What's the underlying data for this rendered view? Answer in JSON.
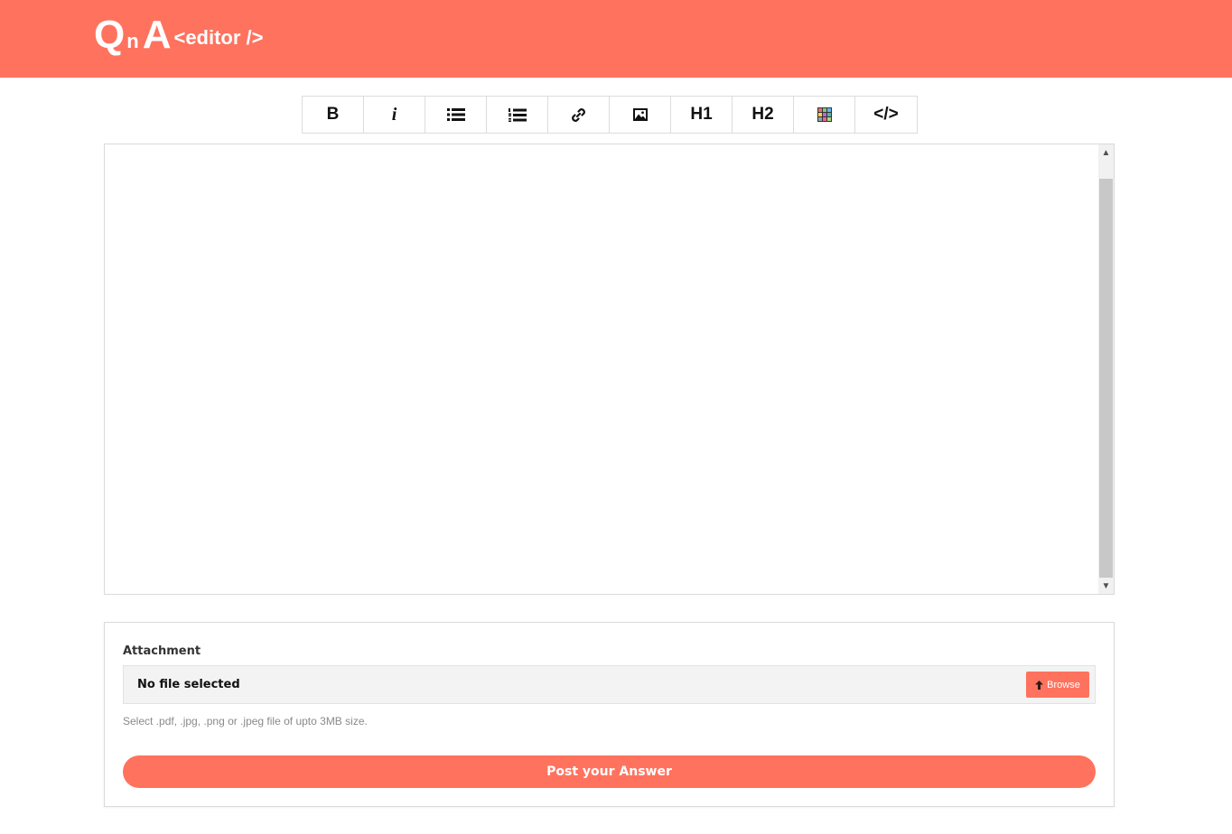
{
  "header": {
    "logo": {
      "q": "Q",
      "n": "n",
      "a": "A",
      "tag": "<editor />"
    },
    "background": "#ff725e"
  },
  "toolbar": {
    "buttons": [
      {
        "id": "bold",
        "label": "B",
        "icon": "bold-icon"
      },
      {
        "id": "italic",
        "label": "i",
        "icon": "italic-icon"
      },
      {
        "id": "bullet-list",
        "label": "",
        "icon": "bullet-list-icon"
      },
      {
        "id": "numbered-list",
        "label": "",
        "icon": "numbered-list-icon"
      },
      {
        "id": "link",
        "label": "",
        "icon": "link-icon"
      },
      {
        "id": "image",
        "label": "",
        "icon": "image-icon"
      },
      {
        "id": "h1",
        "label": "H1",
        "icon": "heading1-icon"
      },
      {
        "id": "h2",
        "label": "H2",
        "icon": "heading2-icon"
      },
      {
        "id": "table",
        "label": "",
        "icon": "table-icon"
      },
      {
        "id": "code",
        "label": "</>",
        "icon": "code-icon"
      }
    ]
  },
  "editor": {
    "content": ""
  },
  "attachment": {
    "label": "Attachment",
    "file_status": "No file selected",
    "browse_label": "Browse",
    "hint": "Select .pdf, .jpg, .png or .jpeg file of upto 3MB size."
  },
  "submit": {
    "label": "Post your Answer"
  },
  "colors": {
    "accent": "#ff725e",
    "border": "#dadada"
  }
}
